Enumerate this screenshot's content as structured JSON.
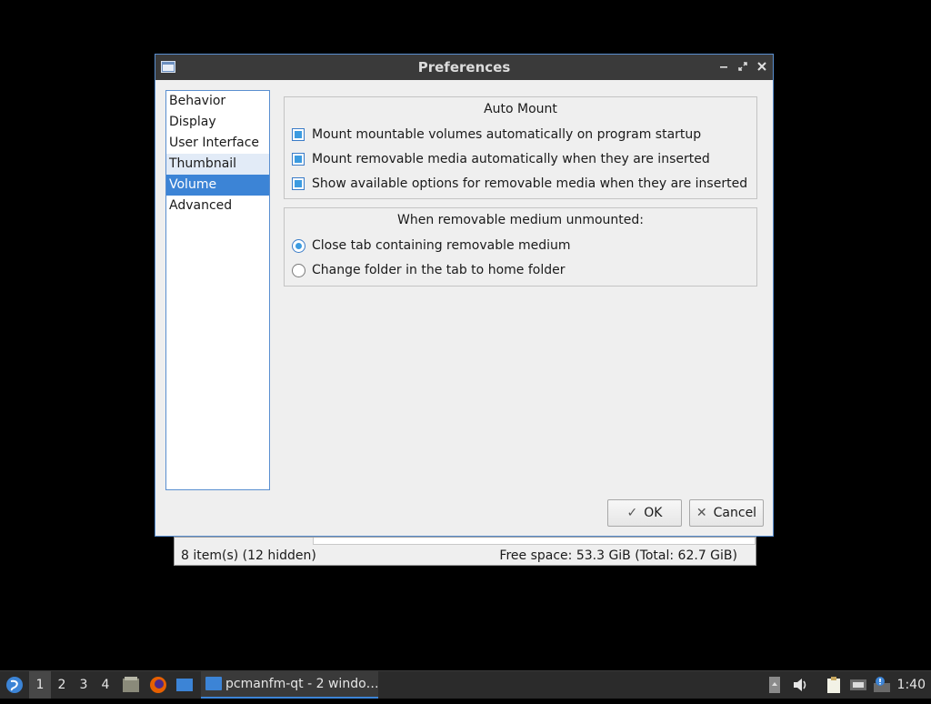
{
  "status_bar": {
    "items_text": "8 item(s) (12 hidden)",
    "space_text": "Free space: 53.3 GiB (Total: 62.7 GiB)"
  },
  "dialog": {
    "title": "Preferences",
    "sidebar": [
      {
        "label": "Behavior"
      },
      {
        "label": "Display"
      },
      {
        "label": "User Interface"
      },
      {
        "label": "Thumbnail"
      },
      {
        "label": "Volume"
      },
      {
        "label": "Advanced"
      }
    ],
    "selected_category": "Volume",
    "auto_mount": {
      "title": "Auto Mount",
      "options": [
        {
          "label": "Mount mountable volumes automatically on program startup",
          "checked": true
        },
        {
          "label": "Mount removable media automatically when they are inserted",
          "checked": true
        },
        {
          "label": "Show available options for removable media when they are inserted",
          "checked": true
        }
      ]
    },
    "unmount": {
      "title": "When removable medium unmounted:",
      "options": [
        {
          "label": "Close tab containing removable medium",
          "selected": true
        },
        {
          "label": "Change folder in the tab to home folder",
          "selected": false
        }
      ]
    },
    "ok_label": "OK",
    "cancel_label": "Cancel"
  },
  "taskbar": {
    "workspaces": [
      "1",
      "2",
      "3",
      "4"
    ],
    "active_workspace": "1",
    "task_label": "pcmanfm-qt - 2 windo…",
    "clock": "1:40"
  },
  "colors": {
    "accent": "#3c84d6",
    "titlebar": "#3a3a3a",
    "taskbar": "#2b2b2b"
  }
}
